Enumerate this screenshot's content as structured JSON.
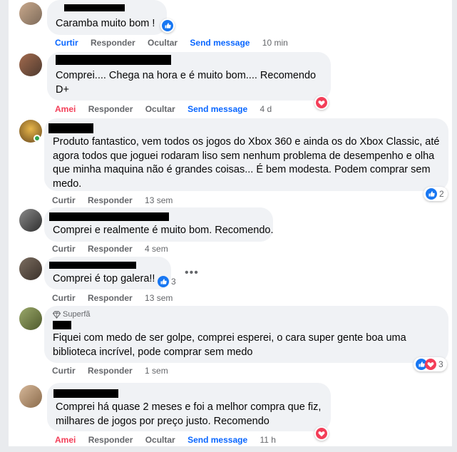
{
  "colors": {
    "like_blue": "#0866ff",
    "love_red": "#f33e58",
    "bubble": "#f0f2f5",
    "meta_gray": "#65676b"
  },
  "comments": [
    {
      "text": "Caramba muito bom !",
      "actions": [
        "Curtir",
        "Responder",
        "Ocultar",
        "Send message"
      ],
      "time": "10 min",
      "reaction": "like-icon"
    },
    {
      "text": "Comprei.... Chega na hora e é muito bom.... Recomendo D+",
      "actions": [
        "Amei",
        "Responder",
        "Ocultar",
        "Send message"
      ],
      "time": "4 d",
      "reaction": "heart-icon"
    },
    {
      "text": "Produto fantastico, vem todos os jogos do Xbox 360 e ainda os do Xbox Classic, até agora todos que joguei rodaram liso sem nenhum problema de desempenho e olha que minha maquina não é grandes coisas... É bem modesta. Podem comprar sem medo.",
      "actions": [
        "Curtir",
        "Responder"
      ],
      "time": "13 sem",
      "reaction": "like-icon",
      "reaction_count": "2"
    },
    {
      "text": "Comprei e realmente é muito bom. Recomendo.",
      "actions": [
        "Curtir",
        "Responder"
      ],
      "time": "4 sem"
    },
    {
      "text": "Comprei é top galera!!",
      "actions": [
        "Curtir",
        "Responder"
      ],
      "time": "13 sem",
      "reaction": "like-icon",
      "reaction_count": "3",
      "more": "•••"
    },
    {
      "badge": "Superfã",
      "text": "Fiquei com medo de ser golpe, comprei esperei, o cara super gente boa uma biblioteca incrível, pode comprar sem medo",
      "actions": [
        "Curtir",
        "Responder"
      ],
      "time": "1 sem",
      "reaction": "like-heart-icons",
      "reaction_count": "3"
    },
    {
      "text": "Comprei há quase 2 meses e foi a melhor compra que fiz, milhares de jogos por preço justo. Recomendo",
      "actions": [
        "Amei",
        "Responder",
        "Ocultar",
        "Send message"
      ],
      "time": "11 h",
      "reaction": "heart-icon"
    }
  ]
}
